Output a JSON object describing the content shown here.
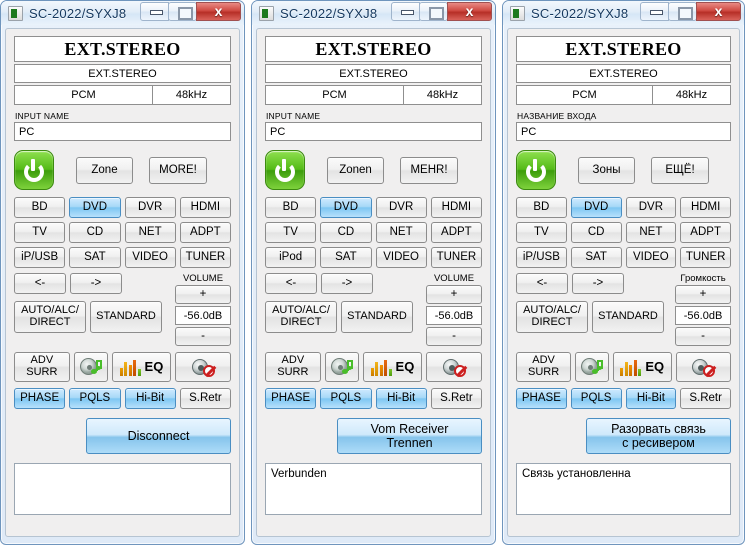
{
  "windows": [
    {
      "title": "SC-2022/SYXJ8",
      "icon": "app-icon",
      "controls": {
        "minimize": "",
        "maximize": "",
        "close": "x"
      },
      "display": {
        "main": "EXT.STEREO",
        "sub": "EXT.STEREO",
        "format": "PCM",
        "rate": "48kHz"
      },
      "input_name": {
        "label": "INPUT NAME",
        "value": "PC"
      },
      "power": {
        "icon": "power-icon"
      },
      "zone_label": "Zone",
      "more_label": "MORE!",
      "sources": [
        {
          "label": "BD",
          "selected": false
        },
        {
          "label": "DVD",
          "selected": true
        },
        {
          "label": "DVR",
          "selected": false
        },
        {
          "label": "HDMI",
          "selected": false
        },
        {
          "label": "TV",
          "selected": false
        },
        {
          "label": "CD",
          "selected": false
        },
        {
          "label": "NET",
          "selected": false
        },
        {
          "label": "ADPT",
          "selected": false
        },
        {
          "label": "iP/USB",
          "selected": false
        },
        {
          "label": "SAT",
          "selected": false
        },
        {
          "label": "VIDEO",
          "selected": false
        },
        {
          "label": "TUNER",
          "selected": false
        }
      ],
      "nav": {
        "prev": "<-",
        "next": "->"
      },
      "volume": {
        "label": "VOLUME",
        "up": "+",
        "value": "-56.0dB",
        "down": "-"
      },
      "modes": {
        "auto": "AUTO/ALC/\nDIRECT",
        "standard": "STANDARD",
        "adv_surr": "ADV\nSURR"
      },
      "icons": {
        "sound": "disc-music-icon",
        "eq": "eq-bars-icon",
        "eq_text": "EQ",
        "mute": "mute-speaker-icon"
      },
      "flags": [
        {
          "label": "PHASE",
          "selected": true
        },
        {
          "label": "PQLS",
          "selected": true
        },
        {
          "label": "Hi-Bit",
          "selected": true
        },
        {
          "label": "S.Retr",
          "selected": false
        }
      ],
      "disconnect_label": "Disconnect",
      "log": ""
    },
    {
      "title": "SC-2022/SYXJ8",
      "icon": "app-icon",
      "controls": {
        "minimize": "",
        "maximize": "",
        "close": "x"
      },
      "display": {
        "main": "EXT.STEREO",
        "sub": "EXT.STEREO",
        "format": "PCM",
        "rate": "48kHz"
      },
      "input_name": {
        "label": "INPUT NAME",
        "value": "PC"
      },
      "power": {
        "icon": "power-icon"
      },
      "zone_label": "Zonen",
      "more_label": "MEHR!",
      "sources": [
        {
          "label": "BD",
          "selected": false
        },
        {
          "label": "DVD",
          "selected": true
        },
        {
          "label": "DVR",
          "selected": false
        },
        {
          "label": "HDMI",
          "selected": false
        },
        {
          "label": "TV",
          "selected": false
        },
        {
          "label": "CD",
          "selected": false
        },
        {
          "label": "NET",
          "selected": false
        },
        {
          "label": "ADPT",
          "selected": false
        },
        {
          "label": "iPod",
          "selected": false
        },
        {
          "label": "SAT",
          "selected": false
        },
        {
          "label": "VIDEO",
          "selected": false
        },
        {
          "label": "TUNER",
          "selected": false
        }
      ],
      "nav": {
        "prev": "<-",
        "next": "->"
      },
      "volume": {
        "label": "VOLUME",
        "up": "+",
        "value": "-56.0dB",
        "down": "-"
      },
      "modes": {
        "auto": "AUTO/ALC/\nDIRECT",
        "standard": "STANDARD",
        "adv_surr": "ADV\nSURR"
      },
      "icons": {
        "sound": "disc-music-icon",
        "eq": "eq-bars-icon",
        "eq_text": "EQ",
        "mute": "mute-speaker-icon"
      },
      "flags": [
        {
          "label": "PHASE",
          "selected": true
        },
        {
          "label": "PQLS",
          "selected": true
        },
        {
          "label": "Hi-Bit",
          "selected": true
        },
        {
          "label": "S.Retr",
          "selected": false
        }
      ],
      "disconnect_label": "Vom Receiver\nTrennen",
      "log": "Verbunden"
    },
    {
      "title": "SC-2022/SYXJ8",
      "icon": "app-icon",
      "controls": {
        "minimize": "",
        "maximize": "",
        "close": "x"
      },
      "display": {
        "main": "EXT.STEREO",
        "sub": "EXT.STEREO",
        "format": "PCM",
        "rate": "48kHz"
      },
      "input_name": {
        "label": "НАЗВАНИЕ ВХОДА",
        "value": "PC"
      },
      "power": {
        "icon": "power-icon"
      },
      "zone_label": "Зоны",
      "more_label": "ЕЩЁ!",
      "sources": [
        {
          "label": "BD",
          "selected": false
        },
        {
          "label": "DVD",
          "selected": true
        },
        {
          "label": "DVR",
          "selected": false
        },
        {
          "label": "HDMI",
          "selected": false
        },
        {
          "label": "TV",
          "selected": false
        },
        {
          "label": "CD",
          "selected": false
        },
        {
          "label": "NET",
          "selected": false
        },
        {
          "label": "ADPT",
          "selected": false
        },
        {
          "label": "iP/USB",
          "selected": false
        },
        {
          "label": "SAT",
          "selected": false
        },
        {
          "label": "VIDEO",
          "selected": false
        },
        {
          "label": "TUNER",
          "selected": false
        }
      ],
      "nav": {
        "prev": "<-",
        "next": "->"
      },
      "volume": {
        "label": "Громкость",
        "up": "+",
        "value": "-56.0dB",
        "down": "-"
      },
      "modes": {
        "auto": "AUTO/ALC/\nDIRECT",
        "standard": "STANDARD",
        "adv_surr": "ADV\nSURR"
      },
      "icons": {
        "sound": "disc-music-icon",
        "eq": "eq-bars-icon",
        "eq_text": "EQ",
        "mute": "mute-speaker-icon"
      },
      "flags": [
        {
          "label": "PHASE",
          "selected": true
        },
        {
          "label": "PQLS",
          "selected": true
        },
        {
          "label": "Hi-Bit",
          "selected": true
        },
        {
          "label": "S.Retr",
          "selected": false
        }
      ],
      "disconnect_label": "Разорвать связь\nс ресивером",
      "log": "Связь установленна"
    }
  ],
  "colors": {
    "accent_blue": "#7ec6f2",
    "power_green": "#55bb18",
    "close_red": "#cf4a42",
    "panel_bg": "#f0efef",
    "window_chrome": "#e2edf8"
  }
}
